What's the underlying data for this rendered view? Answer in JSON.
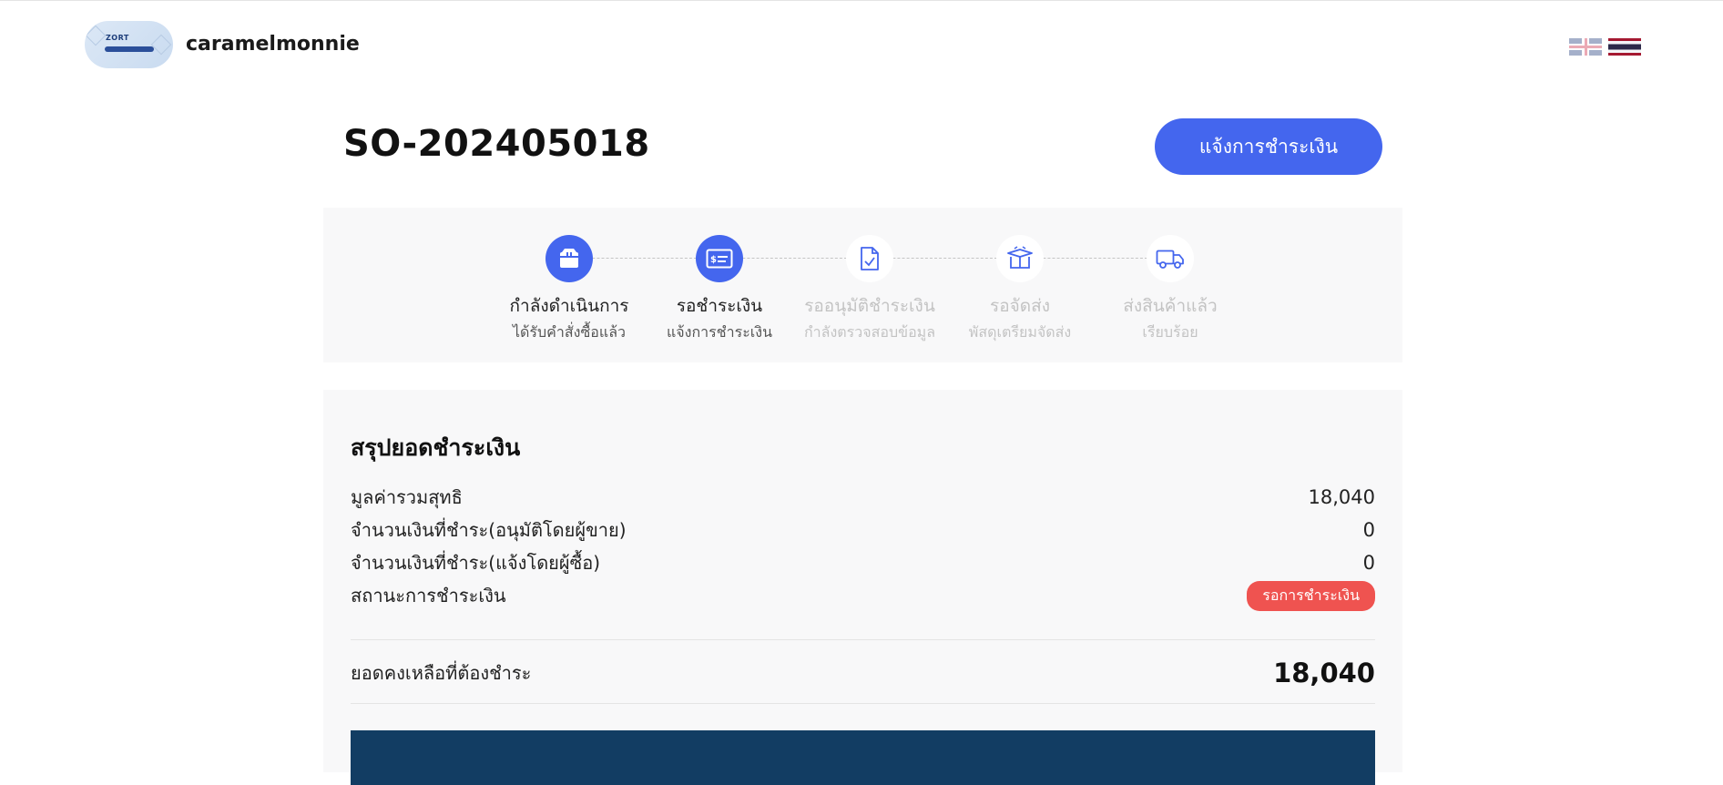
{
  "header": {
    "logo_text": "ZORT",
    "shop_name": "caramelmonnie",
    "languages": [
      {
        "code": "en",
        "icon": "uk-flag-icon",
        "active": false
      },
      {
        "code": "th",
        "icon": "thai-flag-icon",
        "active": true
      }
    ]
  },
  "order": {
    "number": "SO-202405018",
    "notify_button_label": "แจ้งการชำระเงิน"
  },
  "steps": [
    {
      "title": "กำลังดำเนินการ",
      "subtitle": "ได้รับคำสั่งซื้อแล้ว",
      "icon": "box-icon",
      "status": "done"
    },
    {
      "title": "รอชำระเงิน",
      "subtitle": "แจ้งการชำระเงิน",
      "icon": "payment-card-icon",
      "status": "done"
    },
    {
      "title": "รออนุมัติชำระเงิน",
      "subtitle": "กำลังตรวจสอบข้อมูล",
      "icon": "document-check-icon",
      "status": "todo"
    },
    {
      "title": "รอจัดส่ง",
      "subtitle": "พัสดุเตรียมจัดส่ง",
      "icon": "open-box-icon",
      "status": "todo"
    },
    {
      "title": "ส่งสินค้าแล้ว",
      "subtitle": "เรียบร้อย",
      "icon": "truck-icon",
      "status": "todo"
    }
  ],
  "summary": {
    "title": "สรุปยอดชำระเงิน",
    "rows": [
      {
        "label": "มูลค่ารวมสุทธิ",
        "value": "18,040"
      },
      {
        "label": "จำนวนเงินที่ชำระ(อนุมัติโดยผู้ขาย)",
        "value": "0"
      },
      {
        "label": "จำนวนเงินที่ชำระ(แจ้งโดยผู้ซื้อ)",
        "value": "0"
      }
    ],
    "status_label": "สถานะการชำระเงิน",
    "status_value": "รอการชำระเงิน",
    "status_color": "#ef5350",
    "balance_label": "ยอดคงเหลือที่ต้องชำระ",
    "balance_value": "18,040"
  },
  "colors": {
    "accent": "#4466ee",
    "footer_bar": "#123d63",
    "panel_bg": "#f8f8f9"
  }
}
